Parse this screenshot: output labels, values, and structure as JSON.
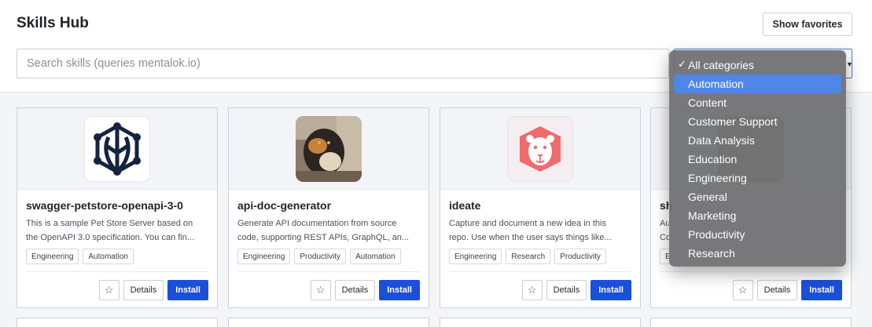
{
  "header": {
    "title": "Skills Hub",
    "favorites_label": "Show favorites",
    "search_placeholder": "Search skills (queries mentalok.io)"
  },
  "category_dropdown": {
    "selected": "All categories",
    "highlighted": "Automation",
    "options": [
      "All categories",
      "Automation",
      "Content",
      "Customer Support",
      "Data Analysis",
      "Education",
      "Engineering",
      "General",
      "Marketing",
      "Productivity",
      "Research"
    ]
  },
  "cards": [
    {
      "name": "swagger-petstore-openapi-3-0",
      "desc_lines": [
        "This is a sample Pet Store Server based on",
        "the OpenAPI 3.0 specification. You can fin..."
      ],
      "tags": [
        "Engineering",
        "Automation"
      ],
      "icon": "network-leaf-icon",
      "star": "☆",
      "details": "Details",
      "install": "Install"
    },
    {
      "name": "api-doc-generator",
      "desc_lines": [
        "Generate API documentation from source",
        "code, supporting REST APIs, GraphQL, an..."
      ],
      "tags": [
        "Engineering",
        "Productivity",
        "Automation"
      ],
      "icon": "cat-photo",
      "star": "☆",
      "details": "Details",
      "install": "Install"
    },
    {
      "name": "ideate",
      "desc_lines": [
        "Capture and document a new idea in this",
        "repo. Use when the user says things like..."
      ],
      "tags": [
        "Engineering",
        "Research",
        "Productivity"
      ],
      "icon": "lion-icon",
      "star": "☆",
      "details": "Details",
      "install": "Install"
    },
    {
      "name": "sh",
      "desc_lines": [
        "Au",
        "Co"
      ],
      "tags": [
        "E"
      ],
      "icon": "blurred-photo",
      "star": "☆",
      "details": "Details",
      "install": "Install"
    }
  ],
  "colors": {
    "accent": "#1a4fd8",
    "dropdown_highlight": "#4f86e8",
    "lion": "#ef6b6e"
  }
}
